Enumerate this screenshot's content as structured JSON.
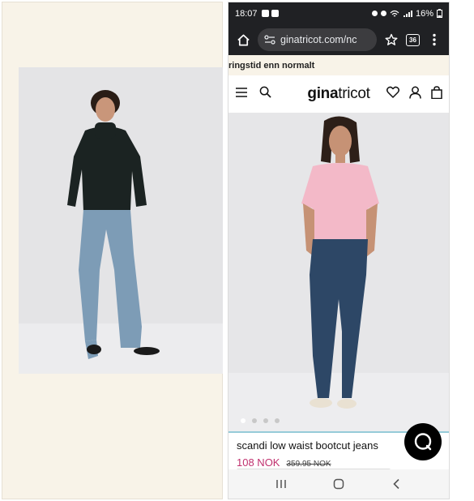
{
  "status_bar": {
    "time": "18:07",
    "battery": "16%"
  },
  "browser": {
    "url": "ginatricot.com/nc",
    "tab_count": "36"
  },
  "promo": {
    "text": "ringstid enn normalt"
  },
  "site": {
    "logo_bold": "gina",
    "logo_regular": "tricot"
  },
  "product": {
    "name": "scandi low waist bootcut jeans",
    "price": "108 NOK",
    "old_price": "359.95 NOK",
    "carousel_count": 4,
    "carousel_active": 1
  },
  "colors": {
    "price": "#c0306e",
    "promo_bg": "#f8f3e8",
    "chrome_bg": "#202124"
  },
  "icons": {
    "home": "home-icon",
    "site_settings": "site-settings-icon",
    "star": "star-icon",
    "tabs": "tabs-icon",
    "menu": "more-vert-icon",
    "hamburger": "hamburger-icon",
    "search": "search-icon",
    "heart": "heart-icon",
    "account": "account-icon",
    "bag": "bag-icon",
    "chat": "chat-icon",
    "recents": "recents-icon",
    "home_nav": "home-nav-icon",
    "back": "back-icon"
  }
}
